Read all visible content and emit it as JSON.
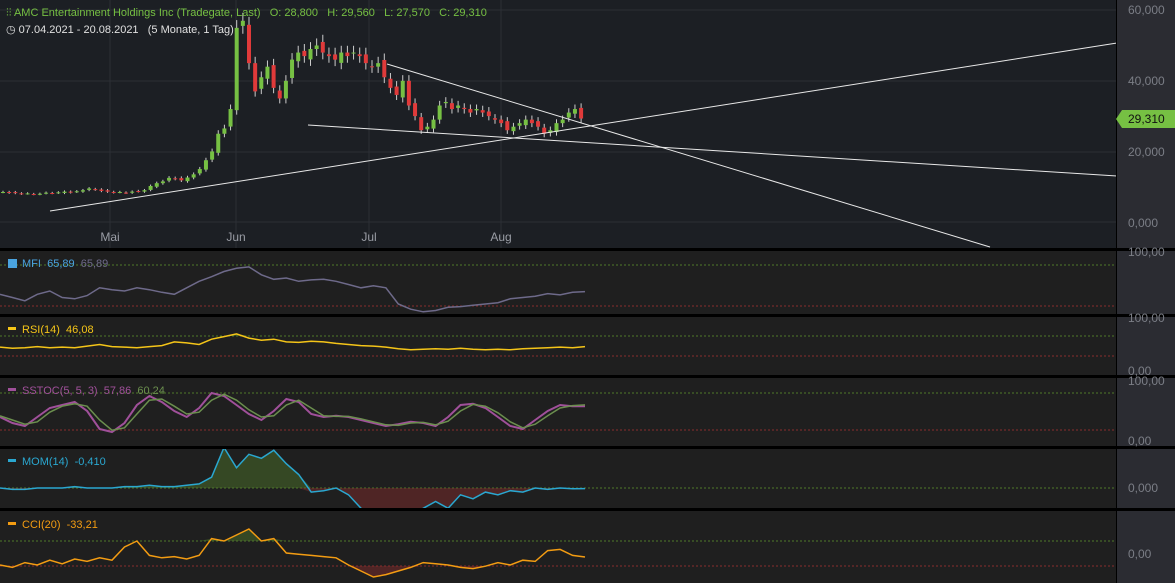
{
  "header": {
    "title": "AMC Entertainment Holdings Inc (Tradegate, Last)",
    "open": "O: 28,800",
    "high": "H: 29,560",
    "low": "L: 27,570",
    "close": "C: 29,310",
    "range": "07.04.2021 - 20.08.2021",
    "period": "(5 Monate, 1 Tag)"
  },
  "price_axis": [
    "60,000",
    "40,000",
    "20,000",
    "0,000"
  ],
  "last_price": "29,310",
  "months": [
    "Mai",
    "Jun",
    "Jul",
    "Aug"
  ],
  "colors": {
    "up": "#76c043",
    "down": "#e03a3a",
    "mfi": "#4aa3df",
    "rsi": "#f5c518",
    "sstoc": "#a0509a",
    "mom": "#2aa7d0",
    "cci": "#f39c12"
  },
  "chart_data": {
    "type": "candlestick",
    "closes_thousands": [
      8.5,
      8.3,
      8.2,
      8.0,
      8.1,
      7.9,
      8.0,
      8.3,
      8.2,
      8.4,
      8.6,
      8.4,
      8.7,
      9.0,
      9.5,
      9.2,
      8.8,
      8.6,
      8.4,
      8.5,
      8.3,
      8.6,
      8.7,
      9.0,
      10.2,
      11,
      11.5,
      12.5,
      12.3,
      11.8,
      12.6,
      13.5,
      15,
      17.5,
      20,
      25,
      26.5,
      32,
      55,
      57,
      45,
      37,
      41,
      44,
      38,
      35,
      40,
      46,
      48,
      47,
      49,
      50,
      48,
      47,
      46,
      48,
      47,
      48,
      47,
      45,
      44,
      45,
      41,
      38,
      36,
      40,
      33,
      30,
      26,
      27,
      29,
      33,
      34,
      32,
      33,
      32,
      31,
      32,
      31,
      30,
      29,
      28,
      26,
      27,
      28,
      29,
      28,
      27,
      25,
      26,
      28,
      29,
      31,
      32,
      29.31
    ],
    "ylim": [
      0,
      60
    ]
  },
  "indicators": {
    "mfi": {
      "label": "MFI",
      "value": "65,89",
      "value2": "65,89",
      "axis": "100,00",
      "values": [
        35,
        30,
        25,
        35,
        40,
        30,
        28,
        33,
        45,
        42,
        40,
        45,
        42,
        38,
        35,
        45,
        55,
        62,
        70,
        75,
        77,
        65,
        58,
        60,
        55,
        57,
        58,
        55,
        50,
        45,
        48,
        45,
        20,
        12,
        8,
        10,
        15,
        16,
        18,
        20,
        22,
        28,
        30,
        32,
        36,
        34,
        38,
        39
      ]
    },
    "rsi": {
      "label": "RSI(14)",
      "value": "46,08",
      "axis_top": "100,00",
      "axis_bottom": "0,00",
      "values": [
        45,
        43,
        44,
        46,
        44,
        45,
        44,
        47,
        50,
        46,
        45,
        44,
        46,
        48,
        55,
        53,
        50,
        60,
        65,
        70,
        62,
        58,
        60,
        55,
        54,
        56,
        55,
        52,
        50,
        48,
        47,
        45,
        42,
        40,
        41,
        42,
        41,
        43,
        41,
        40,
        41,
        40,
        42,
        43,
        44,
        45,
        44,
        46
      ]
    },
    "sstoc": {
      "label": "SSTOC(5, 5, 3)",
      "value": "57,86",
      "value2": "60,24",
      "axis_top": "100,00",
      "axis_bottom": "0,00",
      "k": [
        40,
        30,
        25,
        40,
        55,
        60,
        65,
        50,
        20,
        15,
        30,
        60,
        75,
        65,
        50,
        40,
        55,
        80,
        75,
        60,
        45,
        35,
        50,
        70,
        65,
        45,
        40,
        42,
        40,
        35,
        30,
        25,
        28,
        32,
        30,
        25,
        40,
        60,
        62,
        55,
        40,
        25,
        20,
        35,
        50,
        60,
        58,
        57.86
      ],
      "d": [
        42,
        35,
        28,
        32,
        48,
        58,
        62,
        58,
        35,
        18,
        22,
        45,
        68,
        70,
        58,
        45,
        48,
        68,
        78,
        68,
        52,
        40,
        42,
        60,
        68,
        55,
        42,
        41,
        41,
        37,
        32,
        27,
        26,
        30,
        31,
        27,
        33,
        50,
        61,
        58,
        47,
        32,
        22,
        28,
        42,
        55,
        59,
        60.24
      ]
    },
    "mom": {
      "label": "MOM(14)",
      "value": "-0,410",
      "axis": "0,000",
      "values": [
        0,
        -1,
        -1,
        0,
        0,
        0,
        1,
        0,
        0,
        0,
        1,
        1,
        2,
        1,
        1,
        2,
        3,
        8,
        30,
        15,
        25,
        22,
        28,
        18,
        10,
        -3,
        -2,
        0,
        -5,
        -15,
        -20,
        -18,
        -25,
        -20,
        -15,
        -10,
        -15,
        -5,
        -8,
        -3,
        -5,
        -2,
        -3,
        0,
        -1,
        0,
        -0.5,
        -0.41
      ]
    },
    "cci": {
      "label": "CCI(20)",
      "value": "-33,21",
      "axis": "0,00",
      "values": [
        -100,
        -120,
        -80,
        -100,
        -60,
        -90,
        -50,
        -70,
        -40,
        -60,
        50,
        100,
        -20,
        -40,
        -30,
        -50,
        -20,
        120,
        100,
        150,
        200,
        100,
        120,
        0,
        -10,
        -20,
        -30,
        -40,
        -100,
        -150,
        -200,
        -180,
        -150,
        -120,
        -80,
        -90,
        -100,
        -120,
        -130,
        -110,
        -80,
        -100,
        -60,
        -70,
        20,
        30,
        -20,
        -33.21
      ]
    }
  }
}
